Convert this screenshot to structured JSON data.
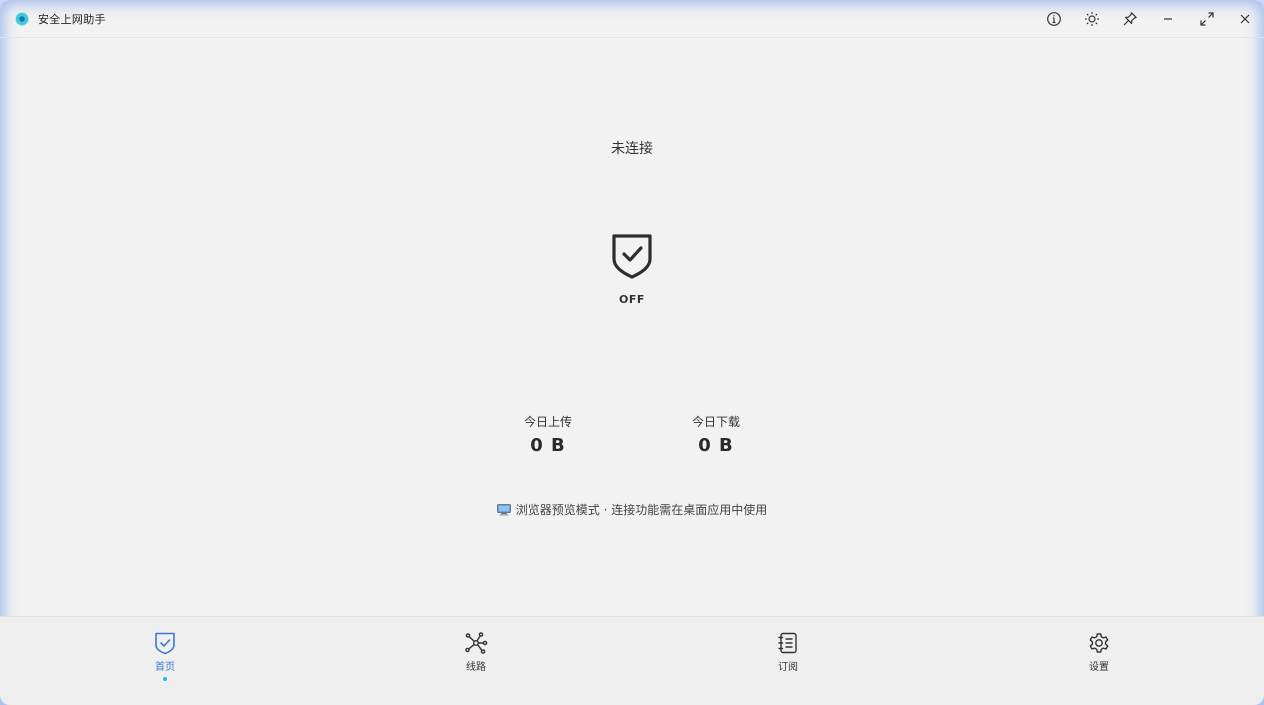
{
  "window": {
    "title": "安全上网助手"
  },
  "titlebar": {
    "buttons": [
      {
        "name": "about",
        "icon": "info-icon"
      },
      {
        "name": "theme",
        "icon": "sun-icon"
      },
      {
        "name": "pin",
        "icon": "pin-icon"
      },
      {
        "name": "minimize",
        "icon": "minimize-icon"
      },
      {
        "name": "maximize",
        "icon": "maximize-icon"
      },
      {
        "name": "close",
        "icon": "close-icon"
      }
    ]
  },
  "main": {
    "status": "未连接",
    "toggle_label": "OFF",
    "toggle_icon": "shield-check-icon",
    "stats": {
      "upload_label": "今日上传",
      "upload_value": "0 B",
      "download_label": "今日下载",
      "download_value": "0 B"
    },
    "notice": {
      "icon": "computer-icon",
      "text": "浏览器预览模式 · 连接功能需在桌面应用中使用"
    }
  },
  "nav": {
    "items": [
      {
        "label": "首页",
        "icon": "shield-check-icon",
        "active": true
      },
      {
        "label": "线路",
        "icon": "network-icon",
        "active": false
      },
      {
        "label": "订阅",
        "icon": "notebook-icon",
        "active": false
      },
      {
        "label": "设置",
        "icon": "gear-icon",
        "active": false
      }
    ]
  },
  "colors": {
    "accent": "#3b78d8",
    "active_dot": "#29b6e8",
    "background": "#f2f2f2",
    "frame_glow": "#a9c3f1"
  }
}
